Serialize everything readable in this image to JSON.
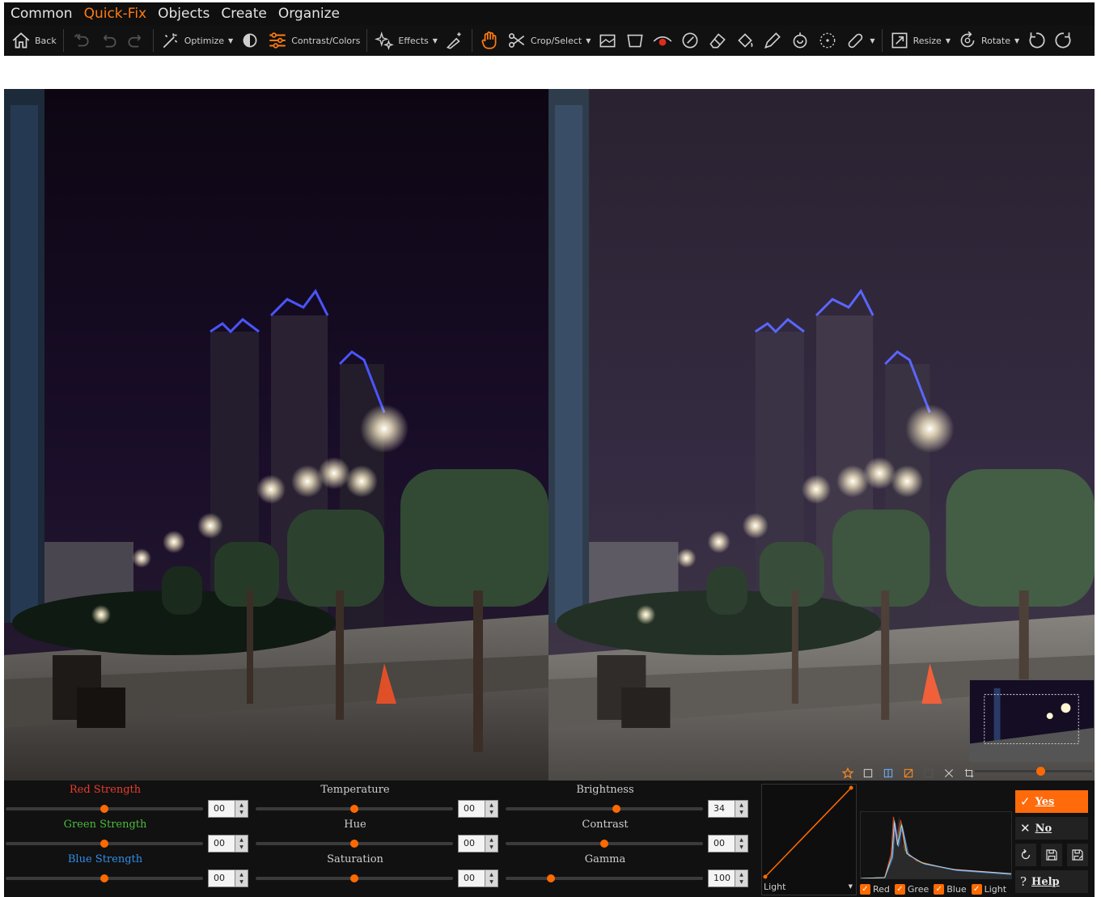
{
  "menu": {
    "items": [
      {
        "label": "Common",
        "active": false
      },
      {
        "label": "Quick-Fix",
        "active": true
      },
      {
        "label": "Objects",
        "active": false
      },
      {
        "label": "Create",
        "active": false
      },
      {
        "label": "Organize",
        "active": false
      }
    ]
  },
  "toolbar": {
    "back_label": "Back",
    "optimize_label": "Optimize",
    "contrast_label": "Contrast/Colors",
    "effects_label": "Effects",
    "crop_label": "Crop/Select",
    "resize_label": "Resize",
    "rotate_label": "Rotate"
  },
  "sliders": {
    "red": {
      "label": "Red Strength",
      "value": "00",
      "color": "#e83c2e",
      "level": 0.5
    },
    "green": {
      "label": "Green Strength",
      "value": "00",
      "color": "#4cbb3c",
      "level": 0.5
    },
    "blue": {
      "label": "Blue Strength",
      "value": "00",
      "color": "#2f8fe8",
      "level": 0.5
    },
    "temperature": {
      "label": "Temperature",
      "value": "00",
      "level": 0.5
    },
    "hue": {
      "label": "Hue",
      "value": "00",
      "level": 0.5
    },
    "saturation": {
      "label": "Saturation",
      "value": "00",
      "level": 0.5
    },
    "brightness": {
      "label": "Brightness",
      "value": "34",
      "level": 0.56
    },
    "contrast": {
      "label": "Contrast",
      "value": "00",
      "level": 0.5
    },
    "gamma": {
      "label": "Gamma",
      "value": "100",
      "level": 0.23
    }
  },
  "curve": {
    "channel": "Light"
  },
  "histogram": {
    "checks": [
      {
        "label": "Red",
        "checked": true
      },
      {
        "label": "Gree",
        "checked": true
      },
      {
        "label": "Blue",
        "checked": true
      },
      {
        "label": "Light",
        "checked": true
      }
    ],
    "zoom_level": 0.56
  },
  "actions": {
    "yes_label": "Yes",
    "no_label": "No",
    "help_label": "Help"
  },
  "colors": {
    "accent": "#ff6a00",
    "panel_bg": "#111111"
  }
}
